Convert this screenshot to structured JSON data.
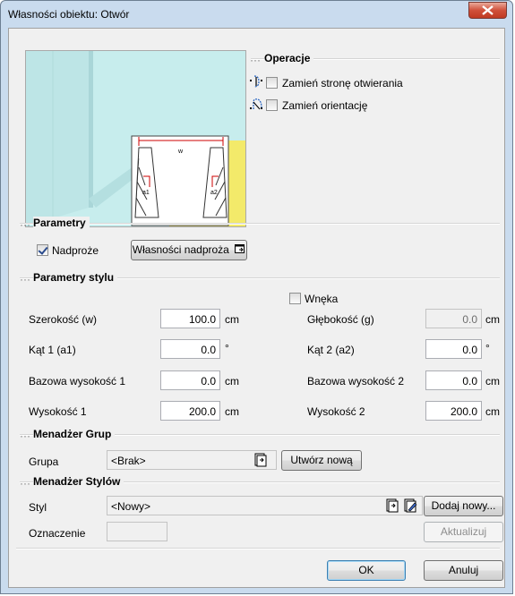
{
  "window": {
    "title": "Własności obiektu: Otwór"
  },
  "preview": {
    "dimension_w": "w",
    "dimension_a1": "a1",
    "dimension_a2": "a2"
  },
  "operations": {
    "section_label": "Operacje",
    "swap_opening_side": {
      "label": "Zamień stronę otwierania",
      "checked": false
    },
    "swap_orientation": {
      "label": "Zamień orientację",
      "checked": false
    }
  },
  "parameters": {
    "section_label": "Parametry",
    "lintel": {
      "label": "Nadproże",
      "checked": true
    },
    "lintel_properties_button": "Własności nadproża"
  },
  "style_parameters": {
    "section_label": "Parametry stylu",
    "niche": {
      "label": "Wnęka",
      "checked": false
    },
    "width": {
      "label": "Szerokość (w)",
      "value": "100.0",
      "unit": "cm"
    },
    "depth": {
      "label": "Głębokość (g)",
      "value": "0.0",
      "unit": "cm"
    },
    "angle1": {
      "label": "Kąt 1 (a1)",
      "value": "0.0",
      "unit": "°"
    },
    "angle2": {
      "label": "Kąt 2 (a2)",
      "value": "0.0",
      "unit": "°"
    },
    "base_height1": {
      "label": "Bazowa wysokość 1",
      "value": "0.0",
      "unit": "cm"
    },
    "base_height2": {
      "label": "Bazowa wysokość 2",
      "value": "0.0",
      "unit": "cm"
    },
    "height1": {
      "label": "Wysokość 1",
      "value": "200.0",
      "unit": "cm"
    },
    "height2": {
      "label": "Wysokość 2",
      "value": "200.0",
      "unit": "cm"
    }
  },
  "group_manager": {
    "section_label": "Menadżer Grup",
    "group_label": "Grupa",
    "group_value": "<Brak>",
    "create_button": "Utwórz nową"
  },
  "style_manager": {
    "section_label": "Menadżer Stylów",
    "style_label": "Styl",
    "style_value": "<Nowy>",
    "add_button": "Dodaj nowy...",
    "designation_label": "Oznaczenie",
    "designation_value": "",
    "update_button": "Aktualizuj"
  },
  "footer": {
    "ok_button": "OK",
    "cancel_button": "Anuluj"
  },
  "colors": {
    "window_frame": "#c9dbee",
    "close_button": "#c8452c",
    "preview_wall": "#c6ecec",
    "preview_floor": "#f3ea6a",
    "dimension_red": "#cc0000"
  }
}
